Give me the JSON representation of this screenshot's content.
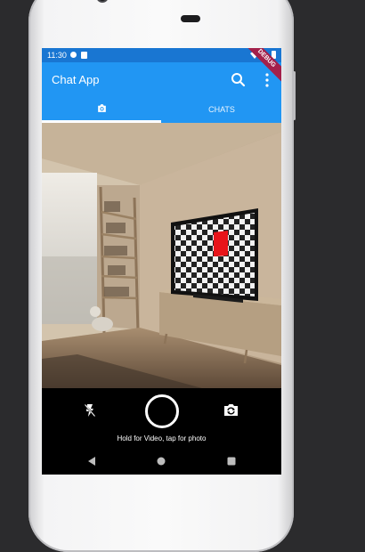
{
  "status_bar": {
    "time": "11:30"
  },
  "app_bar": {
    "title": "Chat App"
  },
  "tabs": [
    {
      "icon": "camera-icon",
      "label": ""
    },
    {
      "label": "CHATS"
    }
  ],
  "debug_banner": "DEBUG",
  "camera": {
    "hint": "Hold for Video, tap for photo"
  },
  "colors": {
    "status_bar": "#1976d2",
    "app_bar": "#2196f3",
    "debug_banner": "#a3204b",
    "tv_marker": "#e8141a"
  },
  "icons": [
    "search-icon",
    "more-vert-icon",
    "camera-icon",
    "flash-off-icon",
    "shutter-button",
    "switch-camera-icon",
    "nav-back-icon",
    "nav-home-icon",
    "nav-recents-icon"
  ]
}
